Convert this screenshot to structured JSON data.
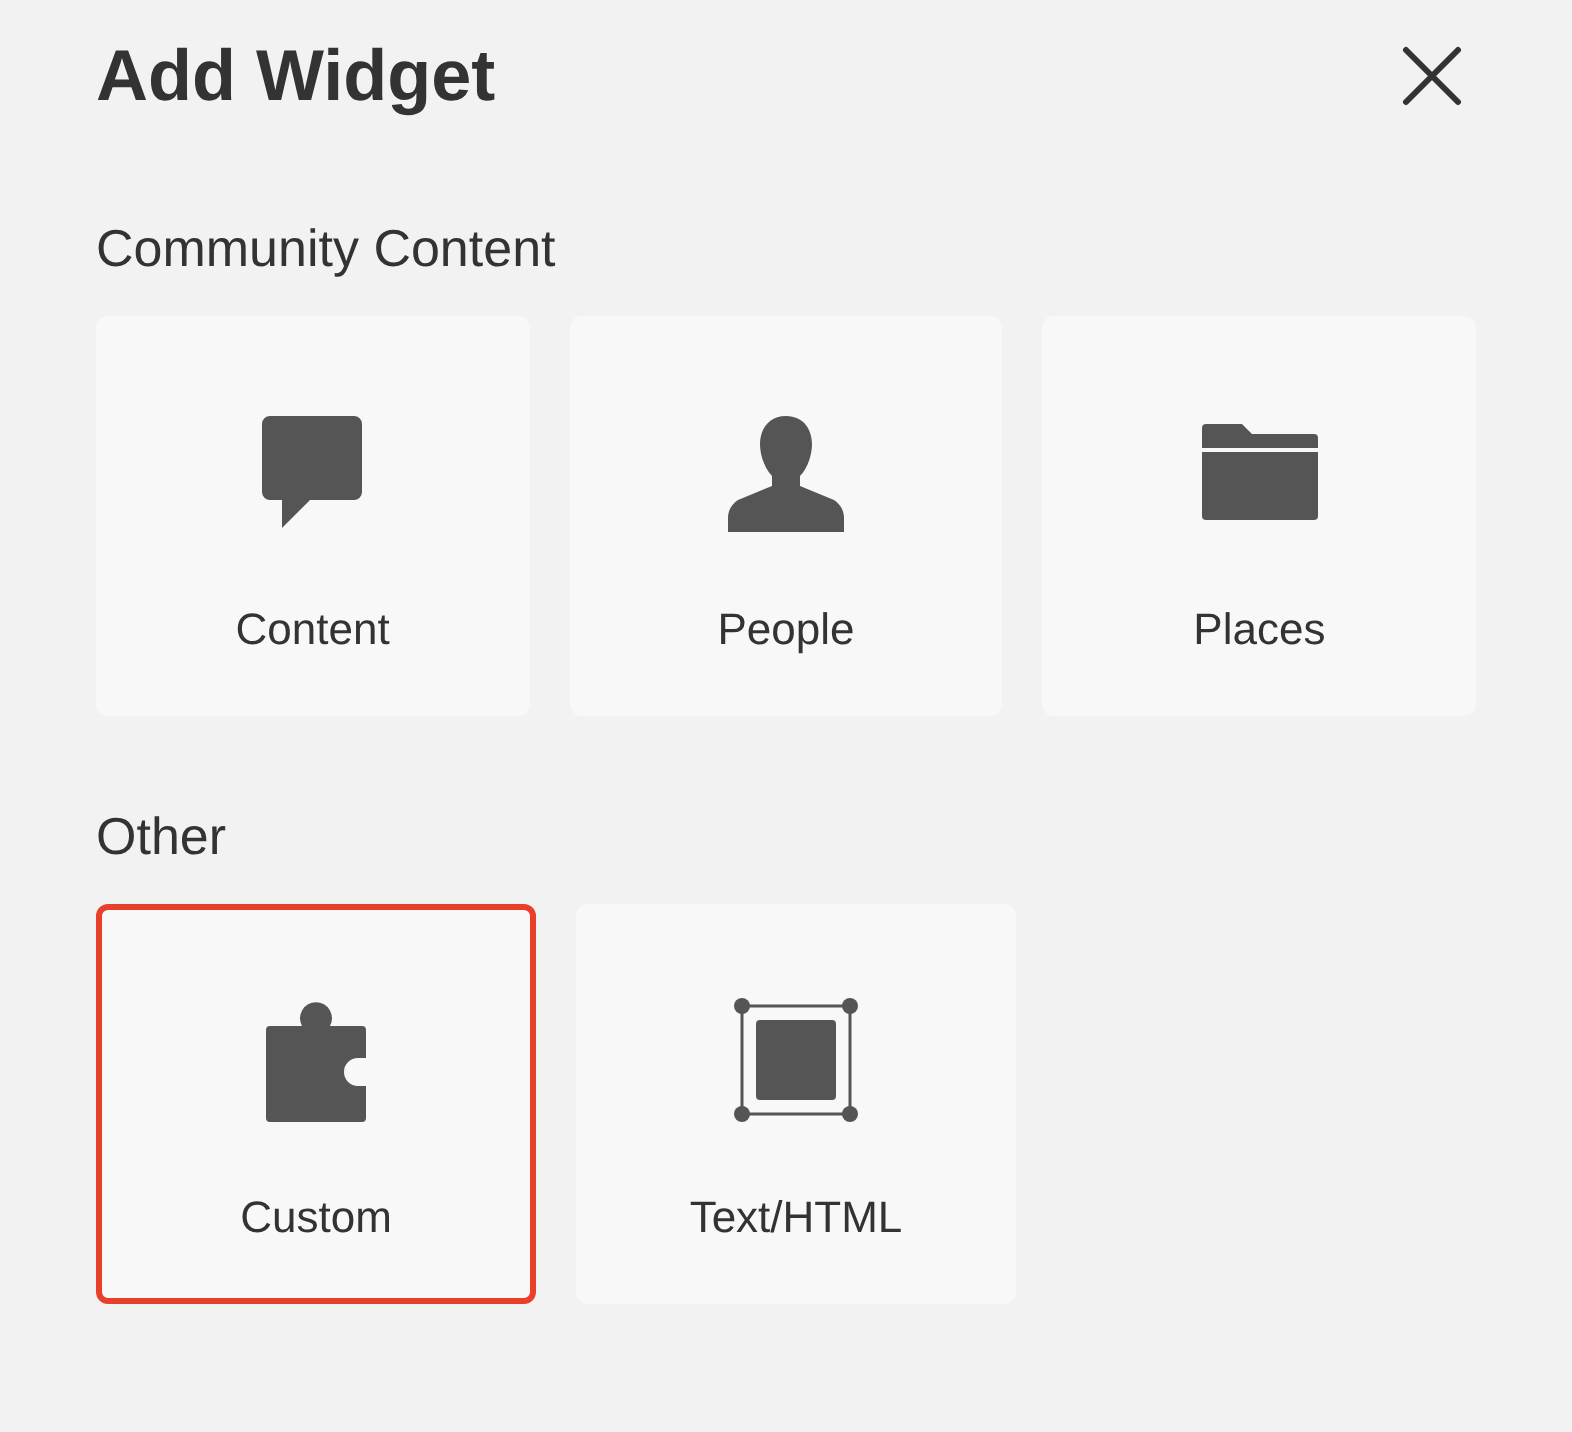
{
  "title": "Add Widget",
  "sections": [
    {
      "heading": "Community Content",
      "widgets": [
        {
          "label": "Content",
          "kind": "bubble",
          "selected": false
        },
        {
          "label": "People",
          "kind": "person",
          "selected": false
        },
        {
          "label": "Places",
          "kind": "folder",
          "selected": false
        }
      ]
    },
    {
      "heading": "Other",
      "widgets": [
        {
          "label": "Custom",
          "kind": "puzzle",
          "selected": true
        },
        {
          "label": "Text/HTML",
          "kind": "frame",
          "selected": false
        }
      ]
    }
  ]
}
